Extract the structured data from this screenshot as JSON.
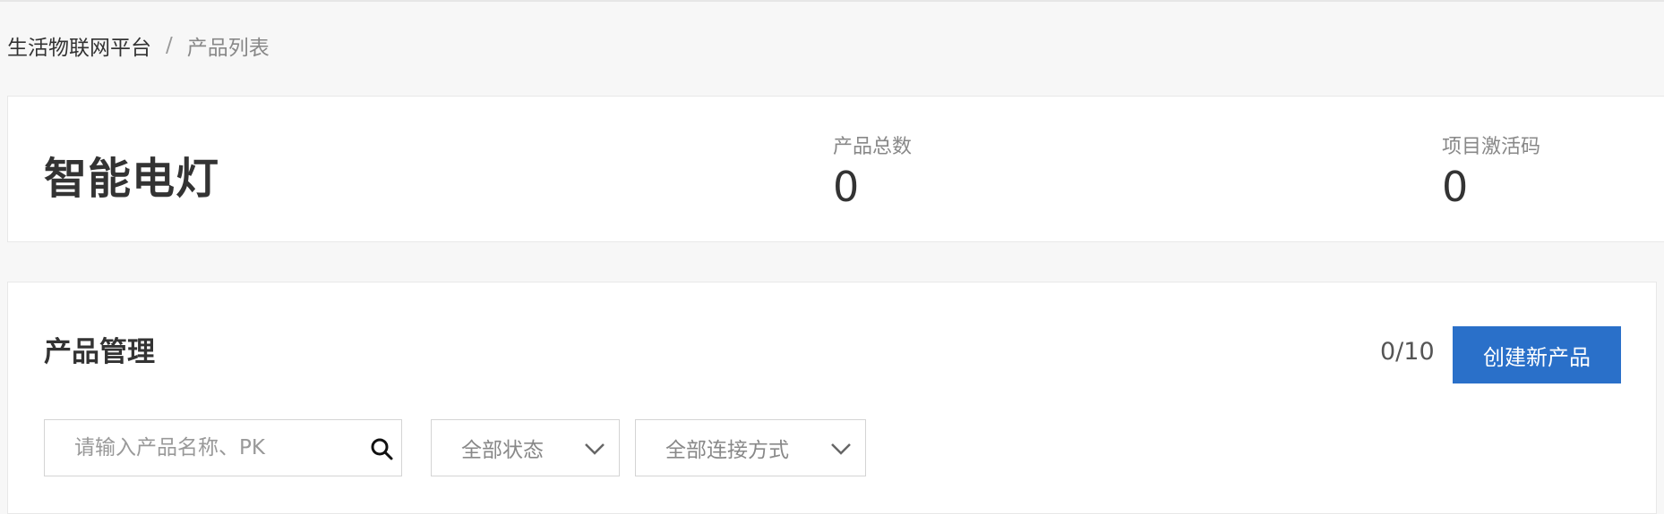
{
  "breadcrumb": {
    "root": "生活物联网平台",
    "separator": "/",
    "current": "产品列表"
  },
  "summary": {
    "product_name": "智能电灯",
    "stats": [
      {
        "label": "产品总数",
        "value": "0"
      },
      {
        "label": "项目激活码",
        "value": "0"
      }
    ]
  },
  "manage": {
    "title": "产品管理",
    "quota": "0/10",
    "create_button": "创建新产品",
    "search": {
      "placeholder": "请输入产品名称、PK",
      "value": "",
      "icon": "search-icon"
    },
    "filters": {
      "status": {
        "selected": "全部状态",
        "icon": "chevron-down-icon"
      },
      "connection": {
        "selected": "全部连接方式",
        "icon": "chevron-down-icon"
      }
    }
  },
  "colors": {
    "page_bg": "#f7f7f7",
    "card_bg": "#ffffff",
    "primary": "#2a70c9",
    "border": "#d4d4d4"
  }
}
